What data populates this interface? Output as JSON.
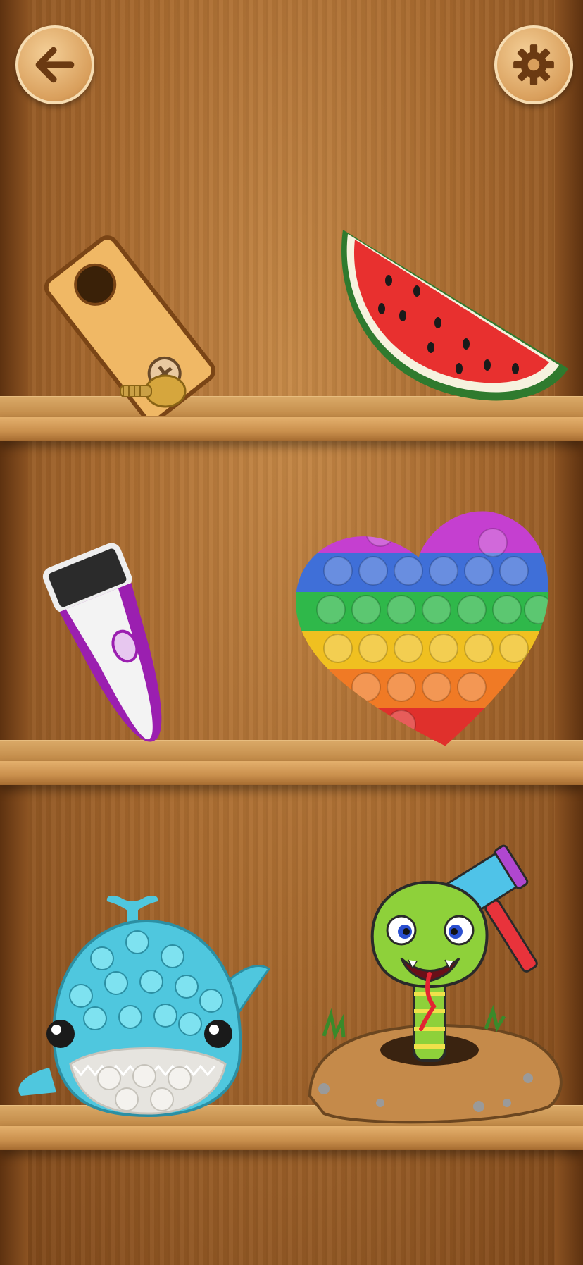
{
  "screen": "toy-shelf-menu",
  "header": {
    "back_icon": "arrow-left-icon",
    "settings_icon": "gear-icon"
  },
  "shelves": [
    {
      "items": [
        {
          "name": "screw-plate-toy"
        },
        {
          "name": "watermelon-toy"
        }
      ]
    },
    {
      "items": [
        {
          "name": "electric-shaver-toy"
        },
        {
          "name": "rainbow-heart-pop-it"
        }
      ]
    },
    {
      "items": [
        {
          "name": "whale-pop-it"
        },
        {
          "name": "whack-a-snake-toy"
        }
      ]
    }
  ],
  "colors": {
    "wood_dark": "#7b4518",
    "wood_light": "#c78a48",
    "button_face": "#d99f5c",
    "icon_brown": "#6b3a12"
  }
}
